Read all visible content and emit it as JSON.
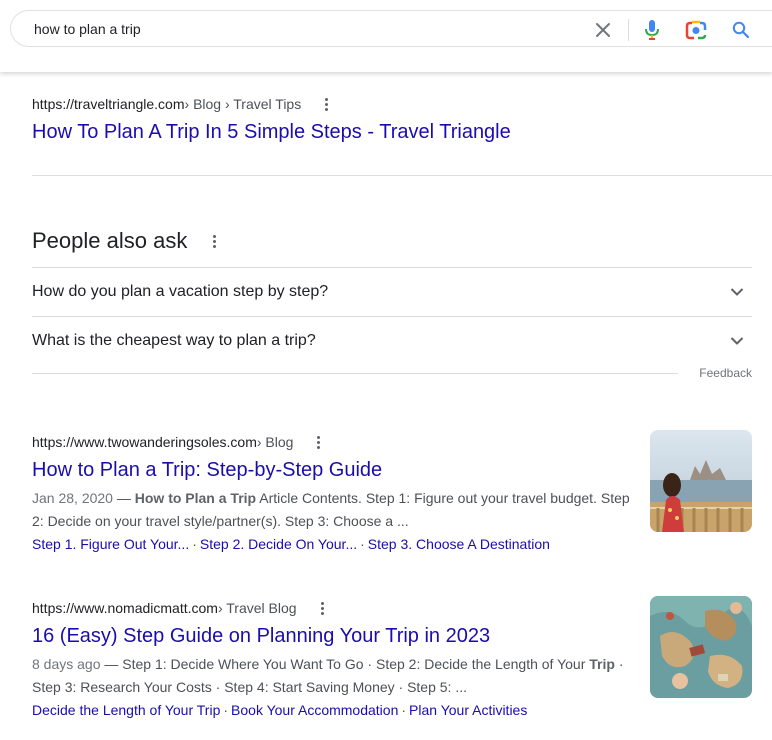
{
  "search": {
    "query": "how to plan a trip"
  },
  "icons": {
    "clear": "close-icon",
    "mic": "microphone-icon",
    "lens": "camera-lens-icon",
    "search": "search-icon"
  },
  "results": [
    {
      "domain": "https://traveltriangle.com",
      "path": " › Blog › Travel Tips",
      "title": "How To Plan A Trip In 5 Simple Steps - Travel Triangle"
    },
    {
      "domain": "https://www.twowanderingsoles.com",
      "path": " › Blog",
      "title": "How to Plan a Trip: Step-by-Step Guide",
      "date": "Jan 28, 2020",
      "dash": " — ",
      "snippet_bold": "How to Plan a Trip",
      "snippet_rest": " Article Contents. Step 1: Figure out your travel budget. Step 2: Decide on your travel style/partner(s). Step 3: Choose a ...",
      "sitelinks": [
        "Step 1. Figure Out Your...",
        "Step 2. Decide On Your...",
        "Step 3. Choose A Destination"
      ]
    },
    {
      "domain": "https://www.nomadicmatt.com",
      "path": " › Travel Blog",
      "title": "16 (Easy) Step Guide on Planning Your Trip in 2023",
      "date": "8 days ago",
      "dash": " — ",
      "snippet_pre": "Step 1: Decide Where You Want To Go · Step 2: Decide the Length of Your ",
      "snippet_bold": "Trip",
      "snippet_rest": " · Step 3: Research Your Costs · Step 4: Start Saving Money · Step 5: ...",
      "sitelinks": [
        "Decide the Length of Your Trip",
        "Book Your Accommodation",
        "Plan Your Activities"
      ]
    }
  ],
  "people_also_ask": {
    "title": "People also ask",
    "questions": [
      "How do you plan a vacation step by step?",
      "What is the cheapest way to plan a trip?"
    ],
    "feedback": "Feedback"
  },
  "sitelink_separator": "·",
  "colors": {
    "link": "#1a0dab",
    "text": "#202124",
    "muted": "#4d5156",
    "divider": "#dadce0",
    "mic_blue": "#4285f4",
    "mic_red": "#ea4335"
  }
}
